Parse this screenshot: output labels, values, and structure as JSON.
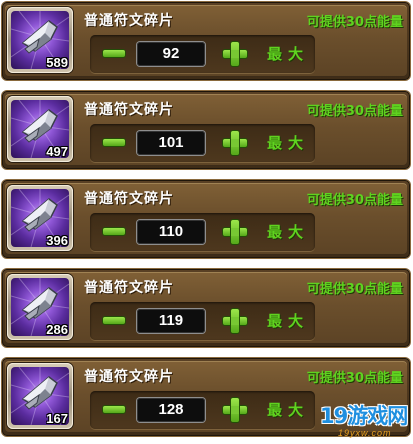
{
  "rows": [
    {
      "item_name": "普通符文碎片",
      "icon": "rune-shard-icon",
      "owned_count": "589",
      "hint": "可提供30点能量",
      "quantity": "92",
      "max_label": "最大"
    },
    {
      "item_name": "普通符文碎片",
      "icon": "rune-shard-icon",
      "owned_count": "497",
      "hint": "可提供30点能量",
      "quantity": "101",
      "max_label": "最大"
    },
    {
      "item_name": "普通符文碎片",
      "icon": "rune-shard-icon",
      "owned_count": "396",
      "hint": "可提供30点能量",
      "quantity": "110",
      "max_label": "最大"
    },
    {
      "item_name": "普通符文碎片",
      "icon": "rune-shard-icon",
      "owned_count": "286",
      "hint": "可提供30点能量",
      "quantity": "119",
      "max_label": "最大"
    },
    {
      "item_name": "普通符文碎片",
      "icon": "rune-shard-icon",
      "owned_count": "167",
      "hint": "可提供30点能量",
      "quantity": "128",
      "max_label": "最大"
    }
  ],
  "icons": {
    "minus": "minus-icon",
    "plus": "plus-icon"
  },
  "watermark": {
    "text": "19游戏网",
    "sub": "19yxw.com"
  },
  "colors": {
    "panel": "#6b4f2c",
    "accent_green": "#5fd21f",
    "icon_purple": "#8f57d6",
    "qty_box": "#0d0d0d",
    "watermark_blue": "#1f8fe0"
  }
}
